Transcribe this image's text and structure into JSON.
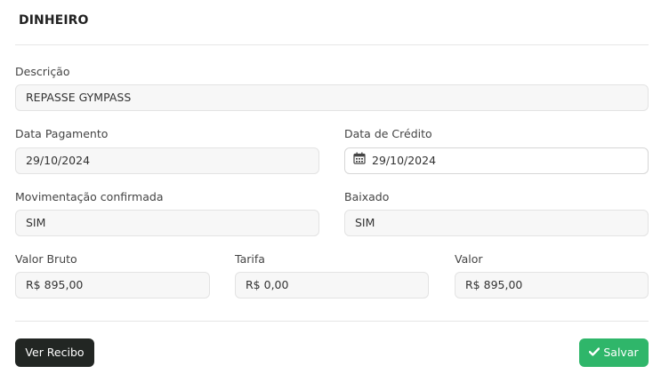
{
  "header": {
    "title": "DINHEIRO"
  },
  "form": {
    "descricao": {
      "label": "Descrição",
      "value": "REPASSE GYMPASS"
    },
    "data_pagamento": {
      "label": "Data Pagamento",
      "value": "29/10/2024"
    },
    "data_credito": {
      "label": "Data de Crédito",
      "value": "29/10/2024",
      "icon": "calendar-icon"
    },
    "movimentacao_confirmada": {
      "label": "Movimentação confirmada",
      "value": "SIM"
    },
    "baixado": {
      "label": "Baixado",
      "value": "SIM"
    },
    "valor_bruto": {
      "label": "Valor Bruto",
      "value": "R$ 895,00"
    },
    "tarifa": {
      "label": "Tarifa",
      "value": "R$ 0,00"
    },
    "valor": {
      "label": "Valor",
      "value": "R$ 895,00"
    }
  },
  "actions": {
    "ver_recibo_label": "Ver Recibo",
    "salvar_label": "Salvar",
    "salvar_icon": "check-icon"
  },
  "colors": {
    "primary_green": "#2fb66a",
    "dark_button": "#222623",
    "field_background": "#f7f7f7"
  }
}
